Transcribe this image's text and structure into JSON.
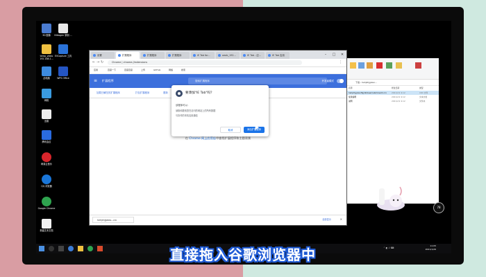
{
  "desktop": {
    "icons": [
      {
        "label": "3D 图像",
        "color": "#4a7bd0",
        "icon": "3d-icon"
      },
      {
        "label": "Nitrogen 录制 ...",
        "color": "#e8e8e8",
        "icon": "app-icon"
      },
      {
        "label": "temp_video 192.168.1...",
        "color": "#f0c040",
        "icon": "folder-icon"
      },
      {
        "label": "EVCapture 工具",
        "color": "#2a72d8",
        "icon": "capture-icon"
      },
      {
        "label": "此电脑",
        "color": "#3d8be0",
        "icon": "computer-icon"
      },
      {
        "label": "WPS Office",
        "color": "#2455c3",
        "icon": "wps-icon"
      },
      {
        "label": "网络",
        "color": "#3a9be0",
        "icon": "network-icon"
      },
      {
        "label": "迅雷",
        "color": "#eeeeee",
        "icon": "thunder-icon"
      },
      {
        "label": "腾讯会议",
        "color": "#2a6be0",
        "icon": "meeting-icon"
      },
      {
        "label": "网易云音乐",
        "color": "#d8252b",
        "icon": "music-icon"
      },
      {
        "label": "QQ 浏览器",
        "color": "#1a76d8",
        "icon": "qq-browser-icon"
      },
      {
        "label": "Google Chrome",
        "color": "#2fa44f",
        "icon": "chrome-icon"
      },
      {
        "label": "新建文本文档",
        "color": "#f2f2f2",
        "icon": "document-icon"
      }
    ]
  },
  "chrome": {
    "tabs": [
      {
        "label": "设置"
      },
      {
        "label": "扩展程序",
        "active": true
      },
      {
        "label": "扩展程序"
      },
      {
        "label": "扩展程序"
      },
      {
        "label": "iE Tab for..."
      },
      {
        "label": "oeob_192..."
      },
      {
        "label": "IE Tab - 应..."
      },
      {
        "label": "IE Tab 应用"
      }
    ],
    "url": "Chrome | chrome://extensions",
    "bookmarks": [
      "应用",
      "百度一下",
      "百度百度",
      "上传",
      "GitHub",
      "网络",
      "搜索"
    ],
    "ext_title": "扩展程序",
    "search_placeholder": "搜索扩展程序",
    "dev_mode": "开发者模式",
    "actions": [
      "加载已解压的扩展程序",
      "打包扩展程序",
      "更新"
    ],
    "store_pre": "在 ",
    "store_link": "Chrome 网上应用店",
    "store_post": "中查找扩展程序和主题背景",
    "download_item": "hehjkhjjpkeo...crx",
    "show_all": "全部显示",
    "close_symbol": "✕"
  },
  "dialog": {
    "title": "要添加\"IE Tab\"吗？",
    "subtitle": "该程序可以：",
    "perm1": "读取和更改您在访问的网站上的所有数据",
    "perm2": "与协作的本机应用通信",
    "cancel": "取消",
    "add": "添加扩展程序"
  },
  "explorer": {
    "path": "下载 › hehjkhjjpkeo...",
    "headers": [
      "名称",
      "修改日期",
      "类型"
    ],
    "files": [
      {
        "name": "hehjkhjjpkeofbjjdkkbeamabmkoadd.crx",
        "date": "2021/2/1 9:12",
        "type": "CRX 文件"
      },
      {
        "name": "使用说明",
        "date": "2021/2/1 9:12",
        "type": "文本文档"
      },
      {
        "name": "说明",
        "date": "2021/2/1 9:12",
        "type": "文件夹"
      }
    ]
  },
  "taskbar": {
    "time": "11:05",
    "date": "2021/1/26",
    "badge": "78"
  },
  "caption": "直接拖入谷歌浏览器中",
  "colors": {
    "accent": "#3c6fdc",
    "caption_outline": "#1f5bd6",
    "bg_left": "#d99da3",
    "bg_right": "#cfe9e0"
  }
}
